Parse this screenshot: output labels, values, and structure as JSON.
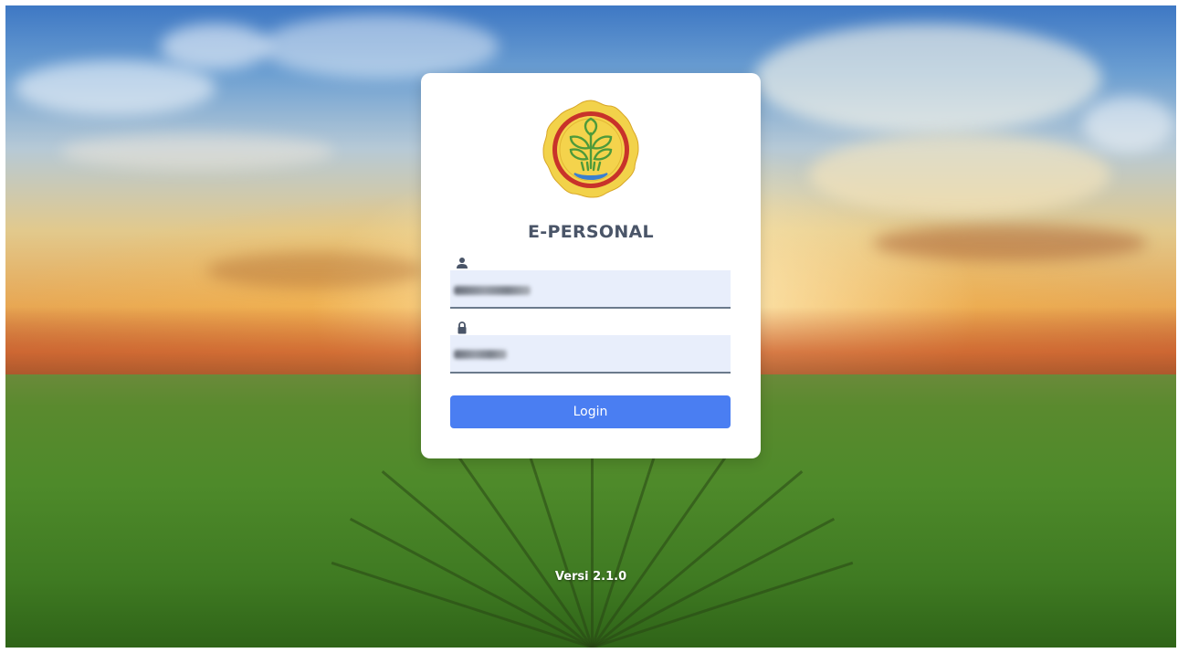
{
  "app": {
    "title": "E-PERSONAL",
    "version_text": "Versi 2.1.0"
  },
  "login_form": {
    "username_icon": "user-icon",
    "password_icon": "lock-icon",
    "login_label": "Login"
  },
  "colors": {
    "button": "#4a7ef2",
    "input_bg": "#e8eefb",
    "title": "#4a5568",
    "logo_gold": "#f2d24a",
    "logo_red": "#c8322a",
    "logo_green": "#4e9a3a"
  }
}
